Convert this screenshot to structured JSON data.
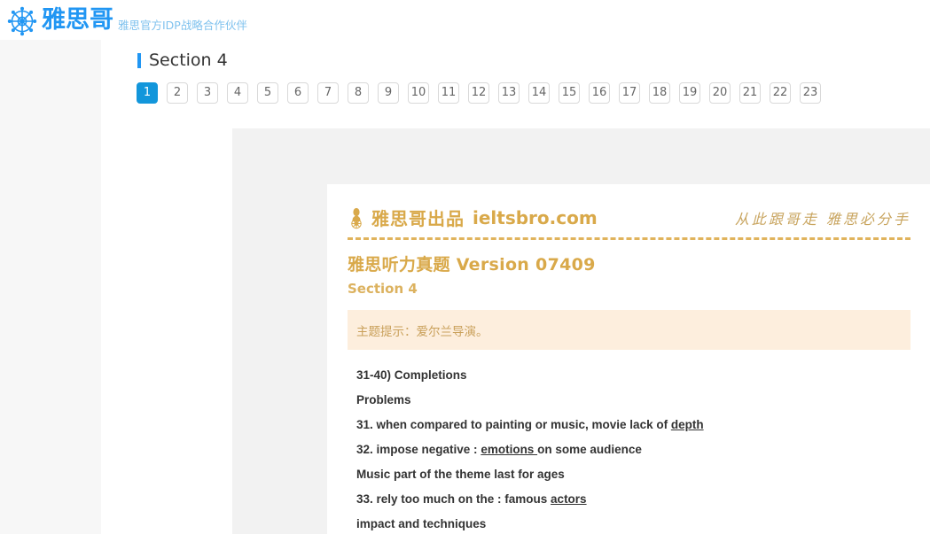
{
  "header": {
    "logo_icon": "ship-wheel-icon",
    "brand_name": "雅思哥",
    "brand_subtitle": "雅思官方IDP战略合作伙伴",
    "brand_color": "#2196f3",
    "subtitle_color": "#7fc2ee"
  },
  "section": {
    "title": "Section 4",
    "accent_color": "#2196f3"
  },
  "pagination": {
    "active": "1",
    "active_color": "#1296db",
    "pages": [
      "1",
      "2",
      "3",
      "4",
      "5",
      "6",
      "7",
      "8",
      "9",
      "10",
      "11",
      "12",
      "13",
      "14",
      "15",
      "16",
      "17",
      "18",
      "19",
      "20",
      "21",
      "22",
      "23"
    ]
  },
  "document": {
    "mascot_icon": "mascot-wheel-icon",
    "brand_cn": "雅思哥出品",
    "brand_en": "ieltsbro.com",
    "slogan": "从此跟哥走  雅思必分手",
    "brand_color": "#d9a94a",
    "title": "雅思听力真题 Version 07409",
    "subtitle": "Section 4",
    "hint": "主题提示：爱尔兰导演。",
    "hint_bg": "#fdeedd",
    "hint_color": "#c9a05a",
    "questions": [
      {
        "text": "31-40)  Completions",
        "answer": "",
        "tail": ""
      },
      {
        "text": "Problems",
        "answer": "",
        "tail": ""
      },
      {
        "text": "31. when compared to painting or music, movie lack of ",
        "answer": "depth ",
        "tail": ""
      },
      {
        "text": "32. impose negative : ",
        "answer": "emotions ",
        "tail": "on some audience"
      },
      {
        "text": "Music part of the theme last for ages",
        "answer": "",
        "tail": ""
      },
      {
        "text": "33. rely too much on the : famous ",
        "answer": "actors ",
        "tail": ""
      },
      {
        "text": "impact and techniques",
        "answer": "",
        "tail": ""
      }
    ]
  }
}
